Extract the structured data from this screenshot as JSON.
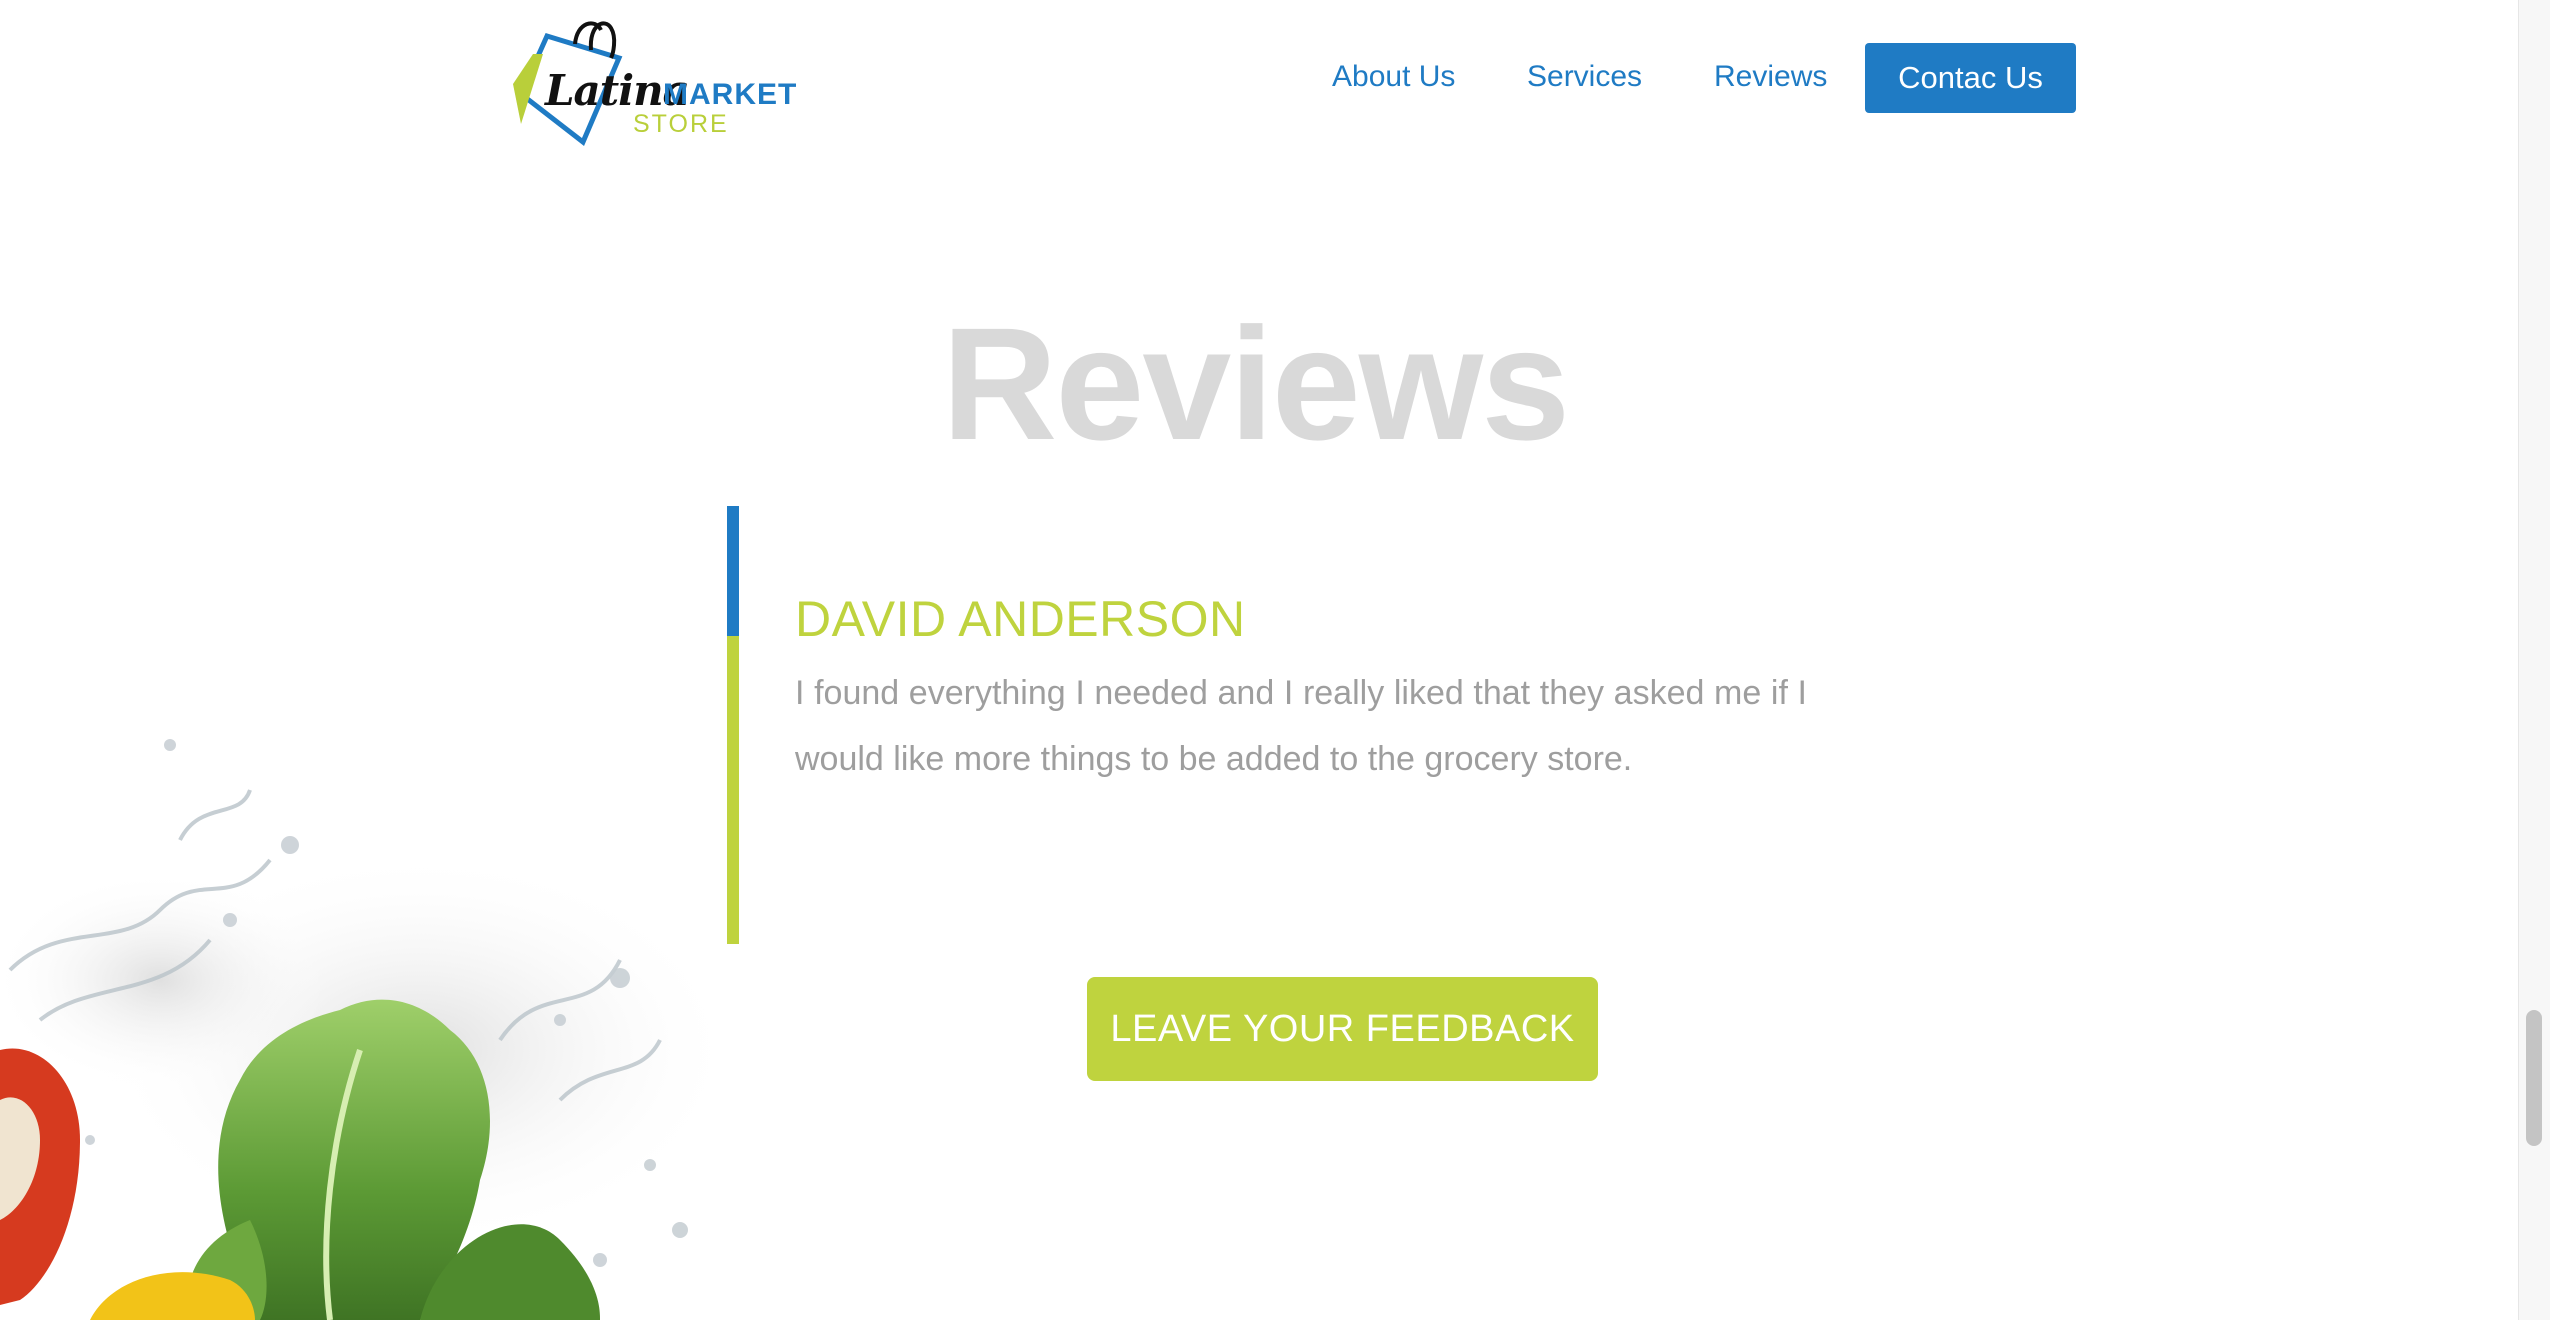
{
  "header": {
    "logo": {
      "latina": "Latina",
      "market": "MARKET",
      "store": "STORE"
    },
    "nav": [
      {
        "label": "About Us"
      },
      {
        "label": "Services"
      },
      {
        "label": "Reviews"
      }
    ],
    "contact_label": "Contac Us"
  },
  "reviews": {
    "title": "Reviews",
    "item": {
      "name": "DAVID ANDERSON",
      "text": "I found everything I needed and I really liked that they asked me if I would like more things to be added to the grocery store."
    },
    "feedback_label": "LEAVE YOUR FEEDBACK"
  },
  "colors": {
    "brand_blue": "#1f7bc4",
    "brand_green": "#bfd33e",
    "title_gray": "#d9d9d9",
    "text_gray": "#9e9e9e"
  },
  "icons": [
    "shopping-bag-icon",
    "vegetables-splash-image"
  ]
}
